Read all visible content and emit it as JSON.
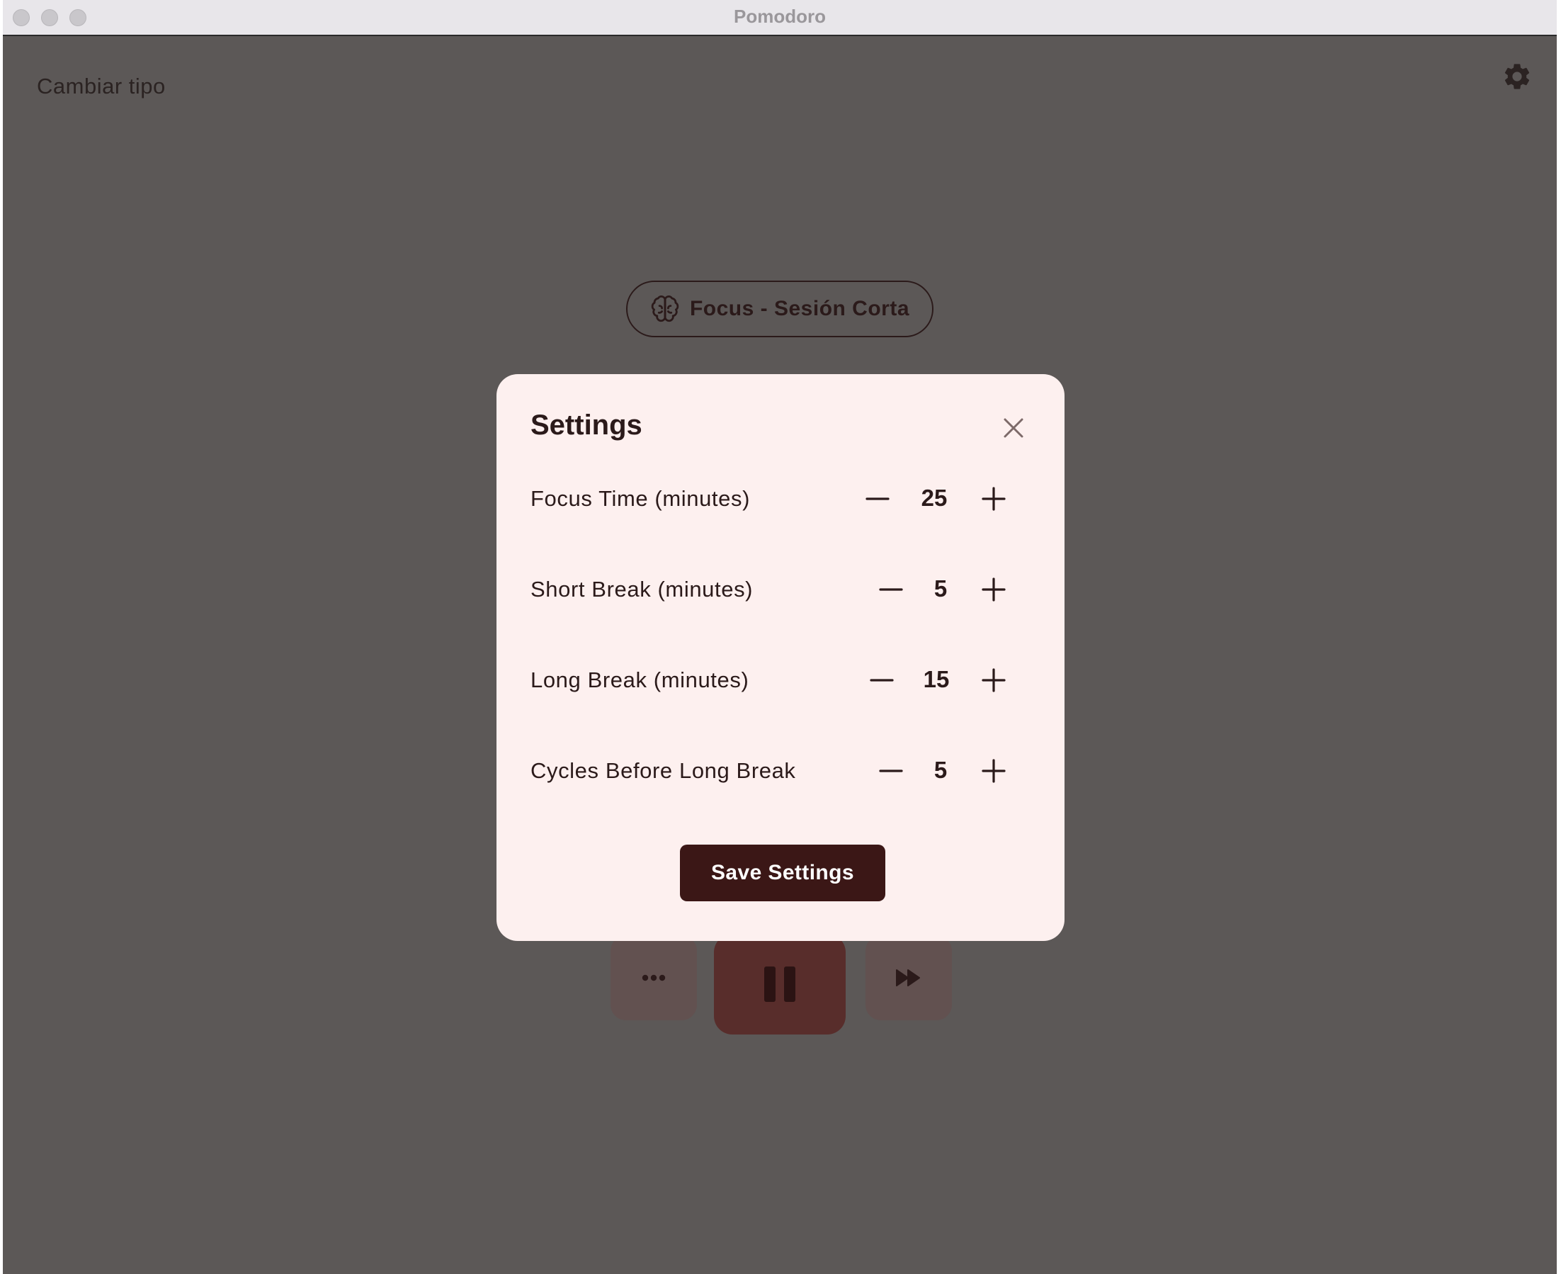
{
  "window": {
    "title": "Pomodoro"
  },
  "header": {
    "change_type_label": "Cambiar tipo",
    "settings_icon": "gear-icon"
  },
  "mode": {
    "label": "Focus - Sesión Corta",
    "icon": "brain-icon"
  },
  "controls": {
    "more_icon": "ellipsis-icon",
    "pause_icon": "pause-icon",
    "skip_icon": "fast-forward-icon"
  },
  "settings_modal": {
    "title": "Settings",
    "close_icon": "close-icon",
    "rows": [
      {
        "label": "Focus Time (minutes)",
        "value": "25"
      },
      {
        "label": "Short Break (minutes)",
        "value": "5"
      },
      {
        "label": "Long Break (minutes)",
        "value": "15"
      },
      {
        "label": "Cycles Before Long Break",
        "value": "5"
      }
    ],
    "save_label": "Save Settings"
  },
  "colors": {
    "background": "#5c5857",
    "modal": "#fdf0ef",
    "accent": "#3b1716",
    "text": "#2b1a1a"
  }
}
